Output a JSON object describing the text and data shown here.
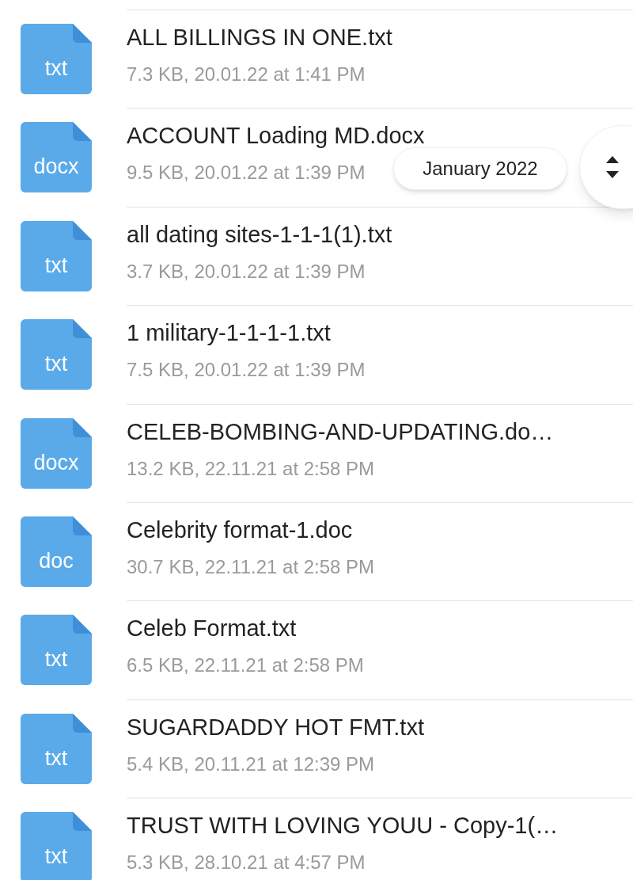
{
  "files": [
    {
      "ext": "txt",
      "name": "ALL BILLINGS IN ONE.txt",
      "meta": "7.3 KB, 20.01.22 at 1:41 PM"
    },
    {
      "ext": "docx",
      "name": "ACCOUNT Loading MD.docx",
      "meta": "9.5 KB, 20.01.22 at 1:39 PM"
    },
    {
      "ext": "txt",
      "name": "all dating sites-1-1-1(1).txt",
      "meta": "3.7 KB, 20.01.22 at 1:39 PM"
    },
    {
      "ext": "txt",
      "name": "1 military-1-1-1-1.txt",
      "meta": "7.5 KB, 20.01.22 at 1:39 PM"
    },
    {
      "ext": "docx",
      "name": "CELEB-BOMBING-AND-UPDATING.do…",
      "meta": "13.2 KB, 22.11.21 at 2:58 PM"
    },
    {
      "ext": "doc",
      "name": "Celebrity format-1.doc",
      "meta": "30.7 KB, 22.11.21 at 2:58 PM"
    },
    {
      "ext": "txt",
      "name": "Celeb Format.txt",
      "meta": "6.5 KB, 22.11.21 at 2:58 PM"
    },
    {
      "ext": "txt",
      "name": "SUGARDADDY HOT FMT.txt",
      "meta": "5.4 KB, 20.11.21 at 12:39 PM"
    },
    {
      "ext": "txt",
      "name": "TRUST WITH LOVING YOUU - Copy-1(…",
      "meta": "5.3 KB, 28.10.21 at 4:57 PM"
    }
  ],
  "date_chip": "January 2022"
}
